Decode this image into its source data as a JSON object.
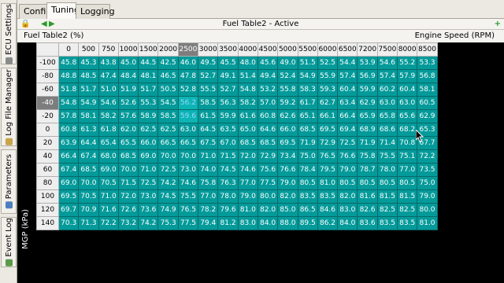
{
  "side_tabs": [
    {
      "label": "ECU Settings",
      "icon": "gear-icon"
    },
    {
      "label": "Log File Manager",
      "icon": "log-file-icon"
    },
    {
      "label": "Parameters",
      "icon": "parameters-icon"
    },
    {
      "label": "Event Log",
      "icon": "event-log-icon"
    }
  ],
  "tabs": [
    {
      "label": "Config"
    },
    {
      "label": "Tuning"
    },
    {
      "label": "Logging"
    }
  ],
  "toolbar": {
    "title": "Fuel Table2 - Active"
  },
  "table": {
    "name": "Fuel Table2 (%)",
    "x_axis_label": "Engine Speed (RPM)",
    "y_axis_label": "MGP (kPa)",
    "columns": [
      "0",
      "500",
      "750",
      "1000",
      "1500",
      "2000",
      "2500",
      "3000",
      "3500",
      "4000",
      "4500",
      "5000",
      "5500",
      "6000",
      "6500",
      "7200",
      "7500",
      "8000",
      "8500"
    ],
    "rows": [
      {
        "label": "-100",
        "values": [
          "45.8",
          "45.3",
          "43.8",
          "45.0",
          "44.5",
          "42.5",
          "46.0",
          "49.5",
          "45.5",
          "48.0",
          "45.6",
          "49.0",
          "51.5",
          "52.5",
          "54.4",
          "53.9",
          "54.6",
          "55.2",
          "53.3"
        ]
      },
      {
        "label": "-80",
        "values": [
          "48.8",
          "48.5",
          "47.4",
          "48.4",
          "48.1",
          "46.5",
          "47.8",
          "52.7",
          "49.1",
          "51.4",
          "49.4",
          "52.4",
          "54.9",
          "55.9",
          "57.4",
          "56.9",
          "57.4",
          "57.9",
          "56.8"
        ]
      },
      {
        "label": "-60",
        "values": [
          "51.8",
          "51.7",
          "51.0",
          "51.9",
          "51.7",
          "50.5",
          "52.8",
          "55.5",
          "52.7",
          "54.8",
          "53.2",
          "55.8",
          "58.3",
          "59.3",
          "60.4",
          "59.9",
          "60.2",
          "60.4",
          "58.1"
        ]
      },
      {
        "label": "-40",
        "values": [
          "54.8",
          "54.9",
          "54.6",
          "52.6",
          "55.3",
          "54.5",
          "56.2",
          "58.5",
          "56.3",
          "58.2",
          "57.0",
          "59.2",
          "61.7",
          "62.7",
          "63.4",
          "62.9",
          "63.0",
          "63.0",
          "60.5"
        ]
      },
      {
        "label": "-20",
        "values": [
          "57.8",
          "58.1",
          "58.2",
          "57.6",
          "58.9",
          "58.5",
          "59.6",
          "61.5",
          "59.9",
          "61.6",
          "60.8",
          "62.6",
          "65.1",
          "66.1",
          "66.4",
          "65.9",
          "65.8",
          "65.6",
          "62.9"
        ]
      },
      {
        "label": "0",
        "values": [
          "60.8",
          "61.3",
          "61.8",
          "62.0",
          "62.5",
          "62.5",
          "63.0",
          "64.5",
          "63.5",
          "65.0",
          "64.6",
          "66.0",
          "68.5",
          "69.5",
          "69.4",
          "68.9",
          "68.6",
          "68.2",
          "65.3"
        ]
      },
      {
        "label": "20",
        "values": [
          "63.9",
          "64.4",
          "65.4",
          "65.5",
          "66.0",
          "66.5",
          "66.5",
          "67.5",
          "67.0",
          "68.5",
          "68.5",
          "69.5",
          "71.9",
          "72.9",
          "72.5",
          "71.9",
          "71.4",
          "70.8",
          "67.7"
        ]
      },
      {
        "label": "40",
        "values": [
          "66.4",
          "67.4",
          "68.0",
          "68.5",
          "69.0",
          "70.0",
          "70.0",
          "71.0",
          "71.5",
          "72.0",
          "72.9",
          "73.4",
          "75.0",
          "76.5",
          "76.6",
          "75.8",
          "75.5",
          "75.1",
          "72.2"
        ]
      },
      {
        "label": "60",
        "values": [
          "67.4",
          "68.5",
          "69.0",
          "70.0",
          "71.0",
          "72.5",
          "73.0",
          "74.0",
          "74.5",
          "74.6",
          "75.6",
          "76.6",
          "78.4",
          "79.5",
          "79.0",
          "78.7",
          "78.0",
          "77.0",
          "73.5"
        ]
      },
      {
        "label": "80",
        "values": [
          "69.0",
          "70.0",
          "70.5",
          "71.5",
          "72.5",
          "74.2",
          "74.6",
          "75.8",
          "76.3",
          "77.0",
          "77.5",
          "79.0",
          "80.5",
          "81.0",
          "80.5",
          "80.5",
          "80.5",
          "80.5",
          "75.0"
        ]
      },
      {
        "label": "100",
        "values": [
          "69.5",
          "70.5",
          "71.0",
          "72.0",
          "73.0",
          "74.5",
          "75.5",
          "77.0",
          "78.0",
          "79.0",
          "80.0",
          "82.0",
          "83.5",
          "83.5",
          "82.0",
          "81.6",
          "81.5",
          "81.5",
          "79.0"
        ]
      },
      {
        "label": "120",
        "values": [
          "69.7",
          "70.9",
          "71.6",
          "72.6",
          "73.6",
          "74.9",
          "76.5",
          "78.2",
          "79.6",
          "81.0",
          "82.0",
          "85.0",
          "86.5",
          "84.6",
          "83.0",
          "82.6",
          "82.5",
          "82.5",
          "80.0"
        ]
      },
      {
        "label": "140",
        "values": [
          "70.3",
          "71.3",
          "72.2",
          "73.2",
          "74.2",
          "75.3",
          "77.5",
          "79.4",
          "81.2",
          "83.0",
          "84.0",
          "88.0",
          "89.5",
          "86.2",
          "84.0",
          "83.6",
          "83.5",
          "83.5",
          "81.0"
        ]
      }
    ],
    "highlight_column_index": 6,
    "highlight_row_index": 3,
    "selected_cells": [
      [
        3,
        6
      ],
      [
        4,
        6
      ]
    ]
  },
  "colors": {
    "cell_bg": "#049a9a",
    "cell_border": "#0b6868",
    "header_highlight": "#7d7d7d",
    "background": "#000000"
  }
}
